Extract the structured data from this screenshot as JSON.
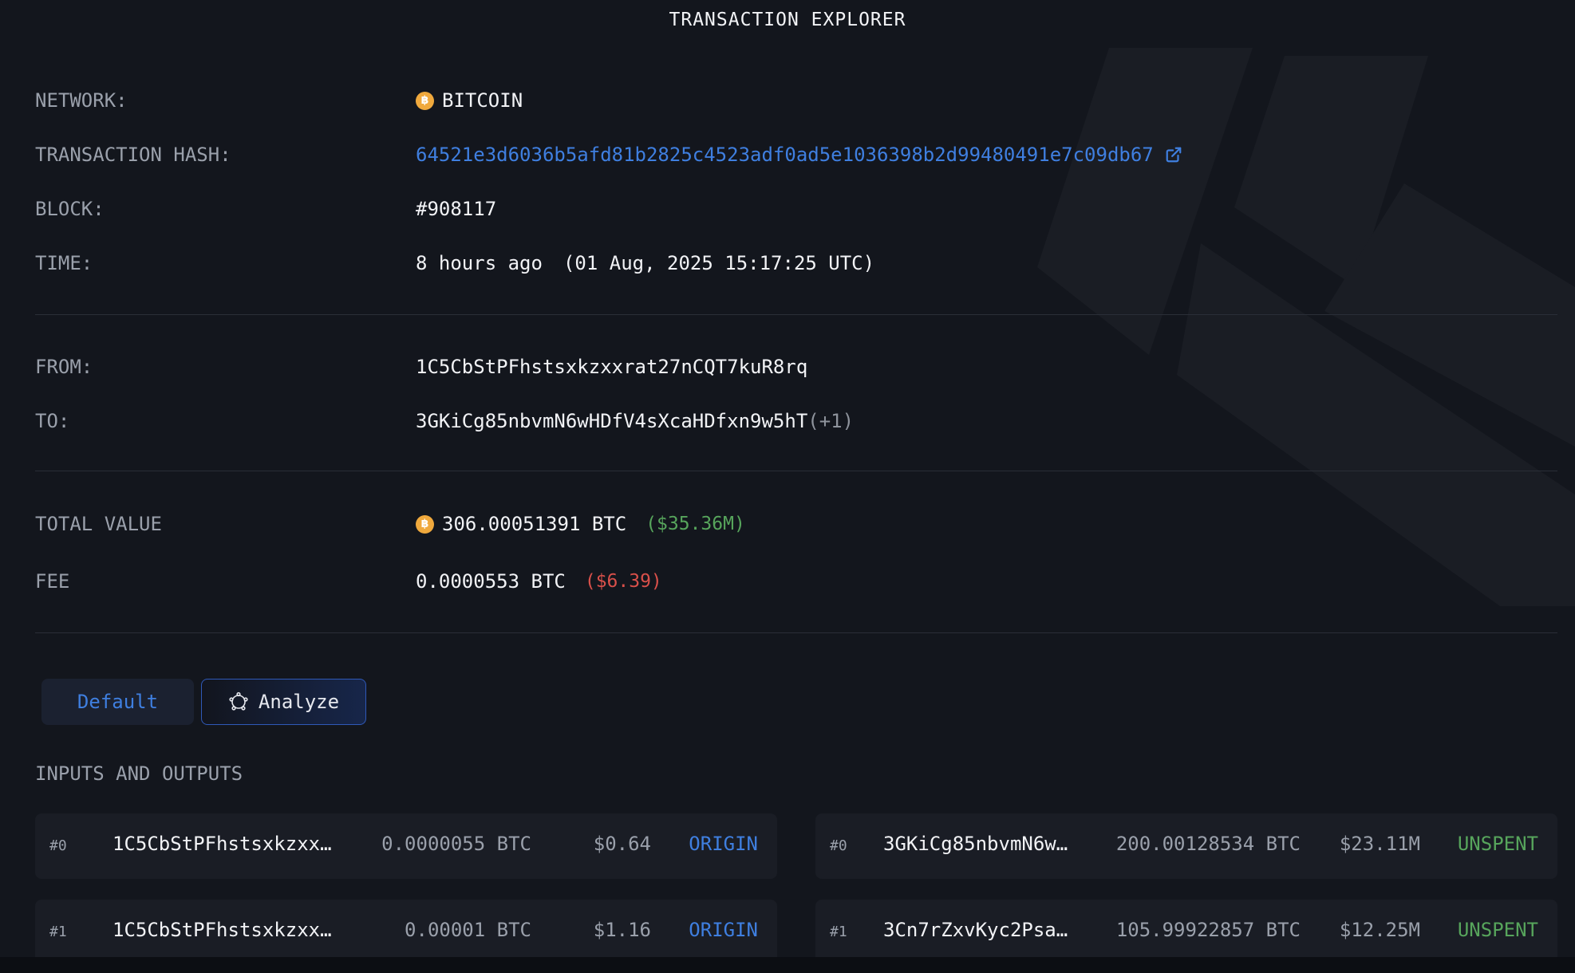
{
  "page_title": "TRANSACTION EXPLORER",
  "details": {
    "network_label": "NETWORK:",
    "network_value": "BITCOIN",
    "hash_label": "TRANSACTION HASH:",
    "hash_value": "64521e3d6036b5afd81b2825c4523adf0ad5e1036398b2d99480491e7c09db67",
    "block_label": "BLOCK:",
    "block_value": "#908117",
    "time_label": "TIME:",
    "time_relative": "8 hours ago",
    "time_absolute": "(01 Aug, 2025 15:17:25 UTC)",
    "from_label": "FROM:",
    "from_value": "1C5CbStPFhstsxkzxxrat27nCQT7kuR8rq",
    "to_label": "TO:",
    "to_value": "3GKiCg85nbvmN6wHDfV4sXcaHDfxn9w5hT",
    "to_extra": "(+1)",
    "total_label": "TOTAL VALUE",
    "total_value": "306.00051391 BTC",
    "total_usd": "($35.36M)",
    "fee_label": "FEE",
    "fee_value": "0.0000553 BTC",
    "fee_usd": "($6.39)"
  },
  "coin_glyph": "฿",
  "view_toggle": {
    "default_label": "Default",
    "analyze_label": "Analyze"
  },
  "io_title": "INPUTS AND OUTPUTS",
  "inputs": [
    {
      "index": "#0",
      "address": "1C5CbStPFhstsxkzxx…",
      "amount": "0.0000055 BTC",
      "usd": "$0.64",
      "status": "ORIGIN"
    },
    {
      "index": "#1",
      "address": "1C5CbStPFhstsxkzxx…",
      "amount": "0.00001 BTC",
      "usd": "$1.16",
      "status": "ORIGIN"
    }
  ],
  "outputs": [
    {
      "index": "#0",
      "address": "3GKiCg85nbvmN6w…",
      "amount": "200.00128534 BTC",
      "usd": "$23.11M",
      "status": "UNSPENT"
    },
    {
      "index": "#1",
      "address": "3Cn7rZxvKyc2Psa…",
      "amount": "105.99922857 BTC",
      "usd": "$12.25M",
      "status": "UNSPENT"
    }
  ],
  "colors": {
    "background": "#13161d",
    "link_blue": "#3f7fe0",
    "positive_green": "#57a55c",
    "negative_red": "#d9504a",
    "bitcoin_orange": "#f0a93d"
  },
  "icons": [
    "bitcoin-icon",
    "external-link-icon",
    "brain-icon"
  ]
}
